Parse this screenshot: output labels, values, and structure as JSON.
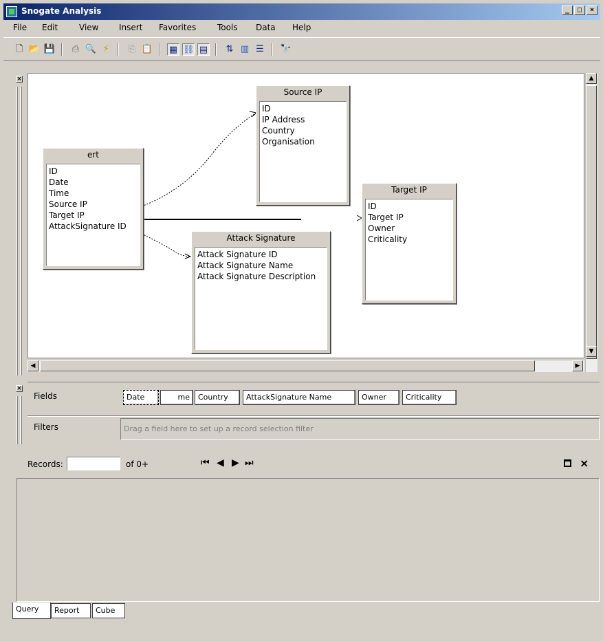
{
  "window": {
    "title": "Snogate Analysis",
    "controls": {
      "minimize": "_",
      "maximize": "□",
      "close": "×"
    }
  },
  "menu": [
    "File",
    "Edit",
    "View",
    "Insert",
    "Favorites",
    "Tools",
    "Data",
    "Help"
  ],
  "toolbar": {
    "icons": [
      "new-icon",
      "open-icon",
      "save-icon",
      "print-icon",
      "print-preview-icon",
      "run-icon",
      "copy-icon",
      "paste-icon",
      "fields-icon",
      "joins-icon",
      "grid-icon",
      "sort-icon",
      "columns-icon",
      "filter-icon",
      "find-icon"
    ]
  },
  "diagram": {
    "tables": [
      {
        "title": "ert",
        "fields": [
          "ID",
          "Date",
          "Time",
          "Source IP",
          "Target IP",
          "AttackSignature ID"
        ]
      },
      {
        "title": "Source IP",
        "fields": [
          "ID",
          "IP Address",
          "Country",
          "Organisation"
        ]
      },
      {
        "title": "Target IP",
        "fields": [
          "ID",
          "Target IP",
          "Owner",
          "Criticality"
        ]
      },
      {
        "title": "Attack Signature",
        "fields": [
          "Attack Signature ID",
          "Attack Signature Name",
          "Attack Signature Description"
        ]
      }
    ]
  },
  "fields_panel": {
    "fields_label": "Fields",
    "filters_label": "Filters",
    "chips": [
      "Date",
      "me",
      "Country",
      "AttackSignature Name",
      "Owner",
      "Criticality"
    ],
    "filters_placeholder": "Drag a field here to set up a record selection filter"
  },
  "records": {
    "label": "Records:",
    "value": "",
    "of_text": "of 0+",
    "nav": [
      "⏮",
      "◀",
      "▶",
      "⏭"
    ]
  },
  "tabs": [
    "Query",
    "Report",
    "Cube"
  ]
}
